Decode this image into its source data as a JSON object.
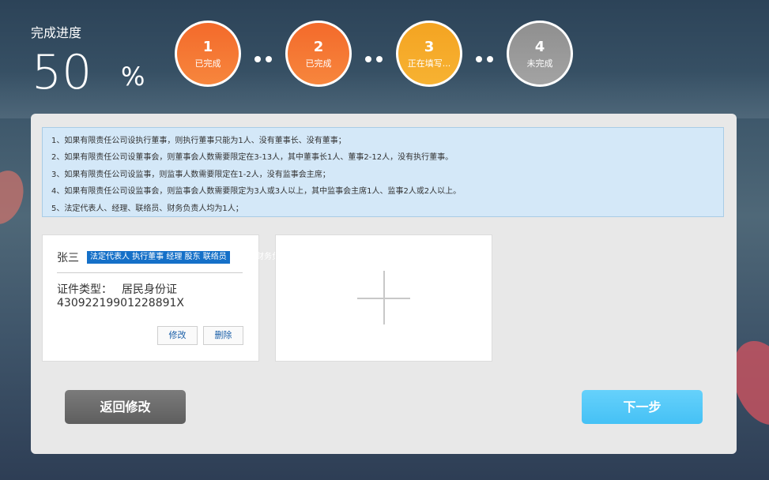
{
  "progress": {
    "title": "完成进度",
    "percent": "50",
    "unit": "%"
  },
  "steps": [
    {
      "num": "1",
      "label": "已完成",
      "state": "done"
    },
    {
      "num": "2",
      "label": "已完成",
      "state": "done"
    },
    {
      "num": "3",
      "label": "正在填写...",
      "state": "current"
    },
    {
      "num": "4",
      "label": "未完成",
      "state": "todo"
    }
  ],
  "notice": {
    "lines": [
      "1、如果有限责任公司设执行董事，则执行董事只能为1人、没有董事长、没有董事；",
      "2、如果有限责任公司设董事会，则董事会人数需要限定在3-13人，其中董事长1人、董事2-12人，没有执行董事。",
      "3、如果有限责任公司设监事，则监事人数需要限定在1-2人，没有监事会主席；",
      "4、如果有限责任公司设监事会，则监事会人数需要限定为3人或3人以上，其中监事会主席1人、监事2人或2人以上。",
      "5、法定代表人、经理、联络员、财务负责人均为1人；"
    ]
  },
  "person": {
    "name": "张三",
    "roles": "法定代表人 执行董事 经理 股东 联络员",
    "roles_overflow": "财务负",
    "id_type_label": "证件类型：",
    "id_type_value": "居民身份证",
    "id_number": "43092219901228891X",
    "edit_label": "修改",
    "delete_label": "删除"
  },
  "actions": {
    "back_label": "返回修改",
    "next_label": "下一步"
  },
  "colors": {
    "step_done": "#f36a2b",
    "step_current": "#f4a422",
    "step_todo": "#9a9a9a",
    "role_highlight": "#1570c8",
    "next_button": "#55c8f8",
    "back_button": "#6b6b6b"
  }
}
